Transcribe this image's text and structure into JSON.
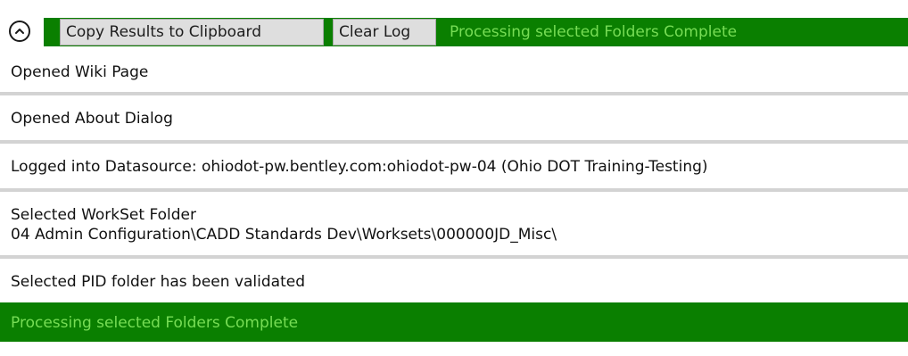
{
  "toolbar": {
    "collapse_icon": "chevron-up-icon",
    "copy_label": "Copy Results to Clipboard",
    "clear_label": "Clear Log",
    "status_text": "Processing selected Folders Complete",
    "status_color": "#0a7f00",
    "status_text_color": "#77dd55"
  },
  "log": {
    "entries": [
      {
        "lines": [
          "Opened Wiki Page"
        ]
      },
      {
        "lines": [
          "Opened About Dialog"
        ]
      },
      {
        "lines": [
          "Logged into Datasource: ohiodot-pw.bentley.com:ohiodot-pw-04 (Ohio DOT Training-Testing)"
        ]
      },
      {
        "lines": [
          "Selected WorkSet Folder",
          "04 Admin Configuration\\CADD Standards Dev\\Worksets\\000000JD_Misc\\"
        ]
      },
      {
        "lines": [
          "Selected PID folder has been validated"
        ]
      },
      {
        "lines": [
          "Processing selected Folders Complete"
        ],
        "highlighted": true
      }
    ]
  }
}
